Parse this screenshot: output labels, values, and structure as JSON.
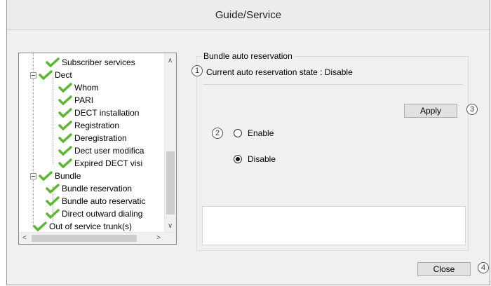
{
  "window": {
    "title": "Guide/Service"
  },
  "tree": {
    "items": [
      {
        "label": "Subscriber services"
      },
      {
        "label": "Dect"
      },
      {
        "label": "Whom"
      },
      {
        "label": "PARI"
      },
      {
        "label": "DECT installation"
      },
      {
        "label": "Registration"
      },
      {
        "label": "Deregistration"
      },
      {
        "label": "Dect user modifica"
      },
      {
        "label": "Expired DECT visi"
      },
      {
        "label": "Bundle"
      },
      {
        "label": "Bundle reservation"
      },
      {
        "label": "Bundle auto reservatic"
      },
      {
        "label": "Direct outward dialing"
      },
      {
        "label": "Out of service trunk(s)"
      }
    ],
    "scroll_up": "∧",
    "scroll_down": "∨",
    "scroll_left": "<",
    "scroll_right": ">"
  },
  "group": {
    "legend": "Bundle auto reservation",
    "state_text": "Current auto reservation state : Disable",
    "apply_label": "Apply",
    "options": [
      {
        "label": "Enable",
        "selected": false
      },
      {
        "label": "Disable",
        "selected": true
      }
    ]
  },
  "footer": {
    "close_label": "Close"
  },
  "callouts": [
    "1",
    "2",
    "3",
    "4"
  ],
  "colors": {
    "check_green": "#5cb82e",
    "accent": "#0078d7"
  }
}
